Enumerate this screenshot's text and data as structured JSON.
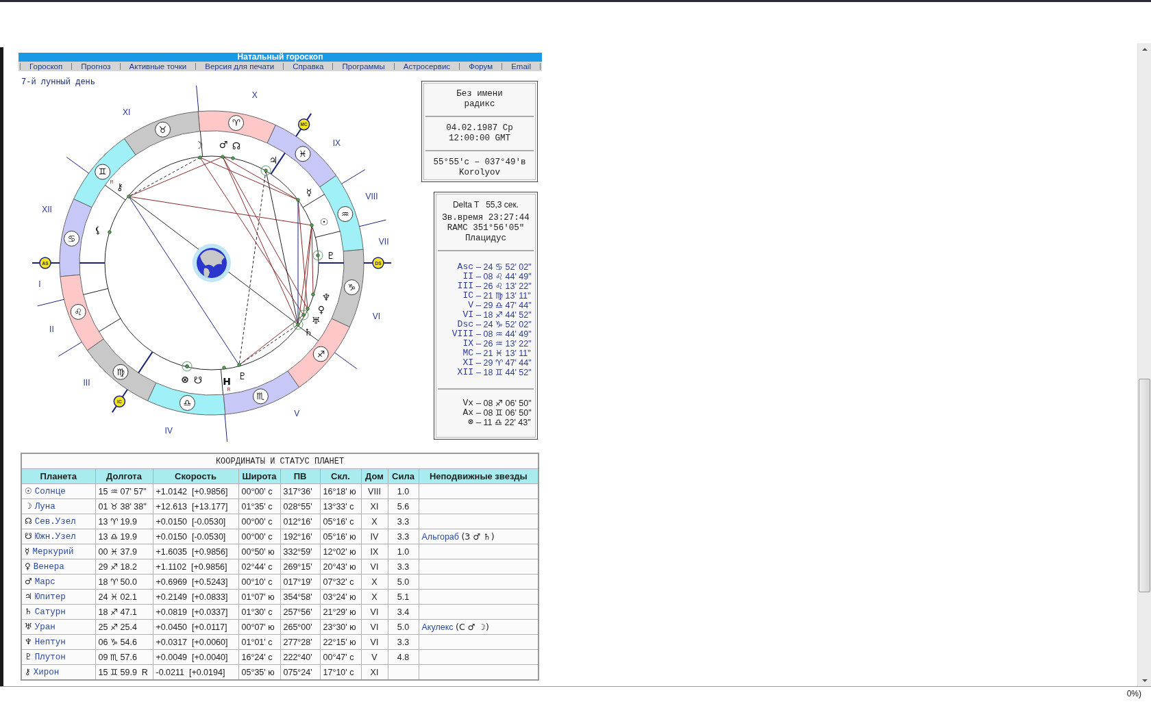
{
  "header": {
    "title": "Натальный гороскоп"
  },
  "nav": [
    {
      "label": "Гороскоп"
    },
    {
      "label": "Прогноз"
    },
    {
      "label": "Активные точки"
    },
    {
      "label": "Версия для печати"
    },
    {
      "label": "Справка"
    },
    {
      "label": "Программы"
    },
    {
      "label": "Астросервис"
    },
    {
      "label": "Форум"
    },
    {
      "label": "Email"
    }
  ],
  "lunar_day": "7-й лунный день",
  "chart": {
    "signs": [
      {
        "glyph": "♈",
        "color": "#ffc8c8"
      },
      {
        "glyph": "♉",
        "color": "#c8c8c8"
      },
      {
        "glyph": "♊",
        "color": "#a0f0f8"
      },
      {
        "glyph": "♋",
        "color": "#c8c8f8"
      },
      {
        "glyph": "♌",
        "color": "#ffc8c8"
      },
      {
        "glyph": "♍",
        "color": "#c8c8c8"
      },
      {
        "glyph": "♎",
        "color": "#a0f0f8"
      },
      {
        "glyph": "♏",
        "color": "#c8c8f8"
      },
      {
        "glyph": "♐",
        "color": "#ffc8c8"
      },
      {
        "glyph": "♑",
        "color": "#c8c8c8"
      },
      {
        "glyph": "♒",
        "color": "#a0f0f8"
      },
      {
        "glyph": "♓",
        "color": "#c8c8f8"
      }
    ],
    "houses": [
      "I",
      "II",
      "III",
      "IV",
      "V",
      "VI",
      "VII",
      "VIII",
      "IX",
      "X",
      "XI",
      "XII"
    ],
    "angles": [
      {
        "label": "AS"
      },
      {
        "label": "MC"
      },
      {
        "label": "DS"
      },
      {
        "label": "IC"
      }
    ],
    "planets": [
      {
        "glyph": "☽"
      },
      {
        "glyph": "♂"
      },
      {
        "glyph": "☊"
      },
      {
        "glyph": "♃"
      },
      {
        "glyph": "⚷",
        "retro_mark": "R"
      },
      {
        "glyph": "☿"
      },
      {
        "glyph": "☉"
      },
      {
        "glyph": "⚸"
      },
      {
        "glyph": "♇"
      },
      {
        "glyph": "♆"
      },
      {
        "glyph": "♀"
      },
      {
        "glyph": "♅"
      },
      {
        "glyph": "♄"
      },
      {
        "glyph": "⊗"
      },
      {
        "glyph": "☋"
      },
      {
        "glyph": "H",
        "retro_mark": "R"
      },
      {
        "glyph": "♇"
      }
    ]
  },
  "info": {
    "sections": [
      [
        "Без имени",
        "радикс"
      ],
      [
        "04.02.1987 Ср",
        "12:00:00 GMT"
      ],
      [
        "55°55'с – 037°49'в",
        "Korolyov"
      ]
    ]
  },
  "details": {
    "delta_t": "Delta T   55,3 сек.",
    "lines": [
      "Зв.время 23:27:44",
      "RAMC 351°56'05\"",
      "Плацидус"
    ],
    "cusps": [
      {
        "label": "Asc",
        "value": "– 24 ♋ 52' 02\""
      },
      {
        "label": "II",
        "value": "– 08 ♌ 44' 49\""
      },
      {
        "label": "III",
        "value": "– 26 ♌ 13' 22\""
      },
      {
        "label": "IC",
        "value": "– 21 ♍ 13' 11\""
      },
      {
        "label": "V",
        "value": "– 29 ♎ 47' 44\""
      },
      {
        "label": "VI",
        "value": "– 18 ♐ 44' 52\""
      },
      {
        "label": "Dsc",
        "value": "– 24 ♑ 52' 02\""
      },
      {
        "label": "VIII",
        "value": "– 08 ♒ 44' 49\""
      },
      {
        "label": "IX",
        "value": "– 26 ♒ 13' 22\""
      },
      {
        "label": "MC",
        "value": "– 21 ♓ 13' 11\""
      },
      {
        "label": "XI",
        "value": "– 29 ♈ 47' 44\""
      },
      {
        "label": "XII",
        "value": "– 18 ♊ 44' 52\""
      }
    ],
    "points": [
      {
        "label": "Vx",
        "value": "– 08 ♐ 06' 50\""
      },
      {
        "label": "Ax",
        "value": "– 08 ♊ 06' 50\""
      },
      {
        "label": "⊗",
        "value": "– 11 ♎ 22' 43\""
      }
    ]
  },
  "table": {
    "title": "КООРДИНАТЫ И СТАТУС ПЛАНЕТ",
    "columns": [
      "Планета",
      "Долгота",
      "Скорость",
      "Широта",
      "ПВ",
      "Скл.",
      "Дом",
      "Сила",
      "Неподвижные звезды"
    ],
    "rows": [
      {
        "cells": [
          {
            "glyph": "☉",
            "name": "Солнце"
          },
          "15 ♒ 07' 57\"",
          "+1.0142  [+0.9856]",
          "00°00' с",
          "317°36'",
          "16°18' ю",
          "VIII",
          "1.0",
          ""
        ]
      },
      {
        "cells": [
          {
            "glyph": "☽",
            "name": "Луна"
          },
          "01 ♉ 38' 38\"",
          "+12.613  [+13.177]",
          "01°35' с",
          "028°55'",
          "13°33' с",
          "XI",
          "5.6",
          ""
        ]
      },
      {
        "cells": [
          {
            "glyph": "☊",
            "name": "Сев.Узел"
          },
          "13 ♈ 19.9",
          "+0.0150  [-0.0530]",
          "00°00' с",
          "012°16'",
          "05°16' с",
          "X",
          "3.3",
          ""
        ]
      },
      {
        "cells": [
          {
            "glyph": "☋",
            "name": "Южн.Узел"
          },
          "13 ♎ 19.9",
          "+0.0150  [-0.0530]",
          "00°00' с",
          "192°16'",
          "05°16' ю",
          "IV",
          "3.3",
          {
            "star": "Альгораб",
            "note": "(3 ♂ ♄)"
          }
        ]
      },
      {
        "cells": [
          {
            "glyph": "☿",
            "name": "Меркурий"
          },
          "00 ♓ 37.9",
          "+1.6035  [+0.9856]",
          "00°50' ю",
          "332°59'",
          "12°02' ю",
          "IX",
          "1.0",
          ""
        ]
      },
      {
        "cells": [
          {
            "glyph": "♀",
            "name": "Венера"
          },
          "29 ♐ 18.2",
          "+1.1102  [+0.9856]",
          "02°44' с",
          "269°15'",
          "20°43' ю",
          "VI",
          "3.3",
          ""
        ]
      },
      {
        "cells": [
          {
            "glyph": "♂",
            "name": "Марс"
          },
          "18 ♈ 50.0",
          "+0.6969  [+0.5243]",
          "00°10' с",
          "017°19'",
          "07°32' с",
          "X",
          "5.0",
          ""
        ]
      },
      {
        "cells": [
          {
            "glyph": "♃",
            "name": "Юпитер"
          },
          "24 ♓ 02.1",
          "+0.2149  [+0.0833]",
          "01°07' ю",
          "354°58'",
          "03°24' ю",
          "X",
          "5.1",
          ""
        ]
      },
      {
        "cells": [
          {
            "glyph": "♄",
            "name": "Сатурн"
          },
          "18 ♐ 47.1",
          "+0.0819  [+0.0337]",
          "01°30' с",
          "257°56'",
          "21°29' ю",
          "VI",
          "3.4",
          ""
        ]
      },
      {
        "cells": [
          {
            "glyph": "♅",
            "name": "Уран"
          },
          "25 ♐ 25.4",
          "+0.0450  [+0.0117]",
          "00°07' ю",
          "265°00'",
          "23°30' ю",
          "VI",
          "5.0",
          {
            "star": "Акулекс",
            "note": "(С ♂ ☽)"
          }
        ]
      },
      {
        "cells": [
          {
            "glyph": "♆",
            "name": "Нептун"
          },
          "06 ♑ 54.6",
          "+0.0317  [+0.0060]",
          "01°01' с",
          "277°28'",
          "22°15' ю",
          "VI",
          "3.3",
          ""
        ]
      },
      {
        "cells": [
          {
            "glyph": "♇",
            "name": "Плутон"
          },
          "09 ♏ 57.6",
          "+0.0049  [+0.0040]",
          "16°24' с",
          "222°40'",
          "00°47' с",
          "V",
          "4.8",
          ""
        ]
      },
      {
        "cells": [
          {
            "glyph": "⚷",
            "name": "Хирон"
          },
          "15 ♊ 59.9  R",
          "-0.0211  [+0.0194]",
          "05°35' ю",
          "075°24'",
          "17°10' с",
          "XI",
          "",
          ""
        ]
      }
    ]
  },
  "status_bar": {
    "zoom": "0%)"
  }
}
